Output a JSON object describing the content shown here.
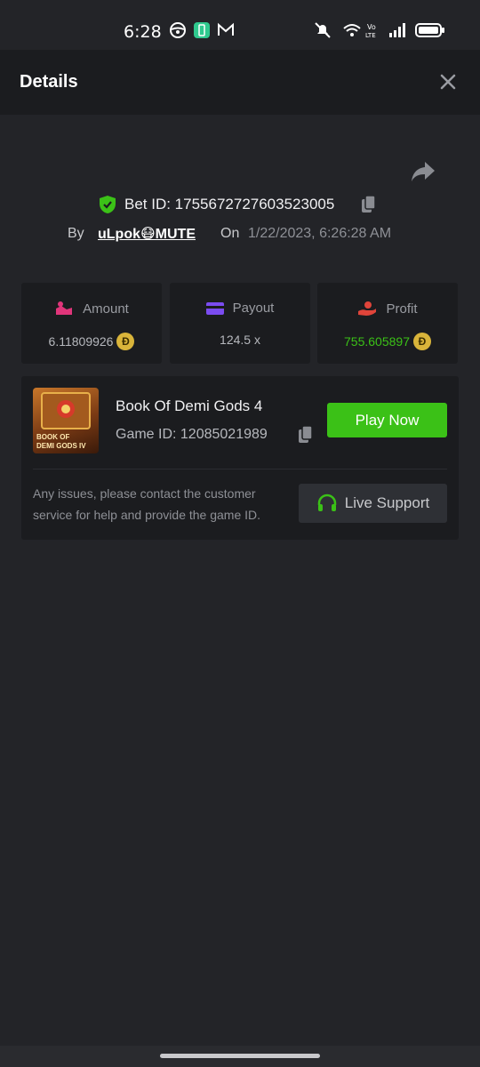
{
  "status_bar": {
    "time": "6:28",
    "icons": [
      "steering-wheel-icon",
      "phone-app-icon",
      "gmail-icon",
      "mute-icon",
      "wifi-icon",
      "volte-icon",
      "signal-icon",
      "battery-icon"
    ]
  },
  "header": {
    "title": "Details",
    "close_icon": "close-icon"
  },
  "bet": {
    "id_text": "Bet ID: 1755672727603523005",
    "by_label": "By",
    "user": "uLpok😷MUTE",
    "on_label": "On",
    "date": "1/22/2023, 6:26:28 AM"
  },
  "stats": [
    {
      "label": "Amount",
      "value": "6.11809926",
      "icon": "amount-icon",
      "coin": "Đ",
      "value_color": "#b6b8bd"
    },
    {
      "label": "Payout",
      "value": "124.5 x",
      "icon": "payout-card-icon",
      "value_color": "#b6b8bd"
    },
    {
      "label": "Profit",
      "value": "755.605897",
      "icon": "profit-hand-icon",
      "coin": "Đ",
      "value_color": "#3bc117"
    }
  ],
  "game": {
    "name": "Book Of Demi Gods 4",
    "id_text": "Game ID: 12085021989",
    "thumb_text": "BOOK OF DEMI GODS IV",
    "play_label": "Play Now",
    "help_text": "Any issues, please contact the customer service for help and provide the game ID.",
    "support_label": "Live Support"
  },
  "colors": {
    "accent_green": "#3bc117",
    "background": "#232428",
    "card": "#1b1c1f",
    "amount_icon": "#e0357a",
    "payout_icon": "#7b4cf0",
    "profit_icon": "#e0443a"
  }
}
